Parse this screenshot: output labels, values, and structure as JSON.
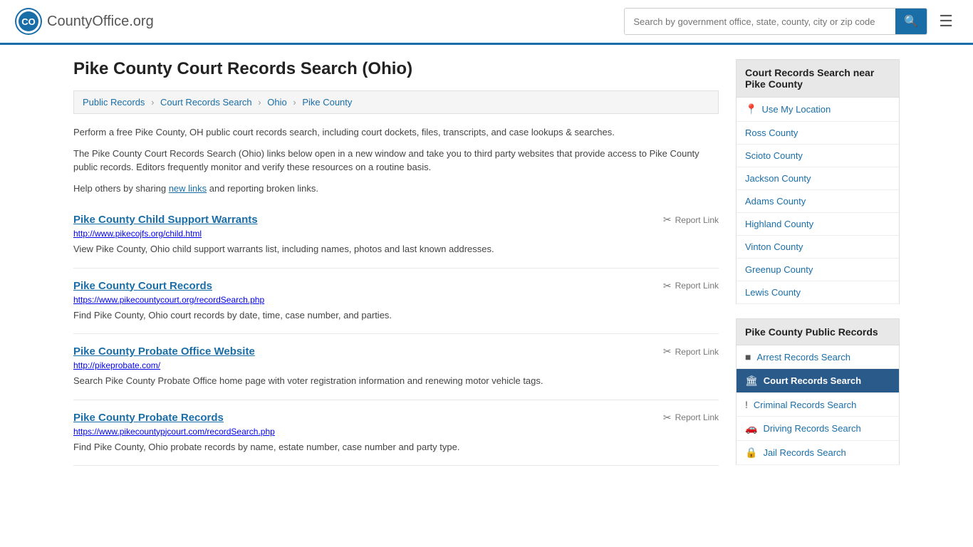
{
  "header": {
    "logo_text": "CountyOffice",
    "logo_suffix": ".org",
    "search_placeholder": "Search by government office, state, county, city or zip code"
  },
  "page": {
    "title": "Pike County Court Records Search (Ohio)",
    "breadcrumb": [
      {
        "label": "Public Records",
        "href": "#"
      },
      {
        "label": "Court Records Search",
        "href": "#"
      },
      {
        "label": "Ohio",
        "href": "#"
      },
      {
        "label": "Pike County",
        "href": "#"
      }
    ],
    "intro1": "Perform a free Pike County, OH public court records search, including court dockets, files, transcripts, and case lookups & searches.",
    "intro2": "The Pike County Court Records Search (Ohio) links below open in a new window and take you to third party websites that provide access to Pike County public records. Editors frequently monitor and verify these resources on a routine basis.",
    "intro3_prefix": "Help others by sharing ",
    "intro3_link": "new links",
    "intro3_suffix": " and reporting broken links."
  },
  "results": [
    {
      "title": "Pike County Child Support Warrants",
      "url": "http://www.pikecojfs.org/child.html",
      "url_color": "blue",
      "description": "View Pike County, Ohio child support warrants list, including names, photos and last known addresses.",
      "report_label": "Report Link"
    },
    {
      "title": "Pike County Court Records",
      "url": "https://www.pikecountycourt.org/recordSearch.php",
      "url_color": "green",
      "description": "Find Pike County, Ohio court records by date, time, case number, and parties.",
      "report_label": "Report Link"
    },
    {
      "title": "Pike County Probate Office Website",
      "url": "http://pikeprobate.com/",
      "url_color": "blue",
      "description": "Search Pike County Probate Office home page with voter registration information and renewing motor vehicle tags.",
      "report_label": "Report Link"
    },
    {
      "title": "Pike County Probate Records",
      "url": "https://www.pikecountypjcourt.com/recordSearch.php",
      "url_color": "green",
      "description": "Find Pike County, Ohio probate records by name, estate number, case number and party type.",
      "report_label": "Report Link"
    }
  ],
  "sidebar": {
    "nearby_title": "Court Records Search near Pike County",
    "use_location_label": "Use My Location",
    "nearby_counties": [
      "Ross County",
      "Scioto County",
      "Jackson County",
      "Adams County",
      "Highland County",
      "Vinton County",
      "Greenup County",
      "Lewis County"
    ],
    "pub_records_title": "Pike County Public Records",
    "pub_records_items": [
      {
        "label": "Arrest Records Search",
        "icon": "■",
        "active": false
      },
      {
        "label": "Court Records Search",
        "icon": "🏛",
        "active": true
      },
      {
        "label": "Criminal Records Search",
        "icon": "!",
        "active": false
      },
      {
        "label": "Driving Records Search",
        "icon": "🚗",
        "active": false
      },
      {
        "label": "Jail Records Search",
        "icon": "🔒",
        "active": false
      }
    ]
  }
}
